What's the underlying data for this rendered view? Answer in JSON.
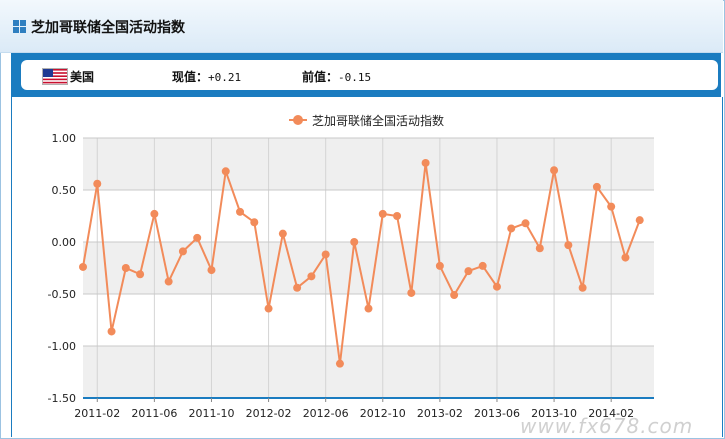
{
  "page": {
    "title": "芝加哥联储全国活动指数"
  },
  "info": {
    "country": "美国",
    "current_label": "现值：",
    "current_value": "+0.21",
    "previous_label": "前值：",
    "previous_value": "-0.15"
  },
  "watermark": "www.fx678.com",
  "colors": {
    "series": "#f28b5a",
    "band": "#efefef",
    "axis": "#1b7cc0",
    "header_band": "#1b7cc0"
  },
  "chart_data": {
    "type": "line",
    "title": "",
    "xlabel": "",
    "ylabel": "",
    "ylim": [
      -1.5,
      1.0
    ],
    "yticks": [
      "1.00",
      "0.50",
      "0.00",
      "-0.50",
      "-1.00",
      "-1.50"
    ],
    "ytick_values": [
      1.0,
      0.5,
      0.0,
      -0.5,
      -1.0,
      -1.5
    ],
    "grid": true,
    "alternating_bands": true,
    "legend": "top-center",
    "xtick_labels": [
      "2011-02",
      "2011-06",
      "2011-10",
      "2012-02",
      "2012-06",
      "2012-10",
      "2013-02",
      "2013-06",
      "2013-10",
      "2014-02"
    ],
    "x": [
      "2011-01",
      "2011-02",
      "2011-03",
      "2011-04",
      "2011-05",
      "2011-06",
      "2011-07",
      "2011-08",
      "2011-09",
      "2011-10",
      "2011-11",
      "2011-12",
      "2012-01",
      "2012-02",
      "2012-03",
      "2012-04",
      "2012-05",
      "2012-06",
      "2012-07",
      "2012-08",
      "2012-09",
      "2012-10",
      "2012-11",
      "2012-12",
      "2013-01",
      "2013-02",
      "2013-03",
      "2013-04",
      "2013-05",
      "2013-06",
      "2013-07",
      "2013-08",
      "2013-09",
      "2013-10",
      "2013-11",
      "2013-12",
      "2014-01",
      "2014-02",
      "2014-03",
      "2014-04",
      "2014-05"
    ],
    "series": [
      {
        "name": "芝加哥联储全国活动指数",
        "values": [
          -0.24,
          0.56,
          -0.86,
          -0.25,
          -0.31,
          0.27,
          -0.38,
          -0.09,
          0.04,
          -0.27,
          0.68,
          0.29,
          0.19,
          -0.64,
          0.08,
          -0.44,
          -0.33,
          -0.12,
          -1.17,
          0.0,
          -0.64,
          0.27,
          0.25,
          -0.49,
          0.76,
          -0.23,
          -0.51,
          -0.28,
          -0.23,
          -0.43,
          0.13,
          0.18,
          -0.06,
          0.69,
          -0.03,
          -0.44,
          0.53,
          0.34,
          -0.15,
          0.21
        ]
      }
    ]
  }
}
